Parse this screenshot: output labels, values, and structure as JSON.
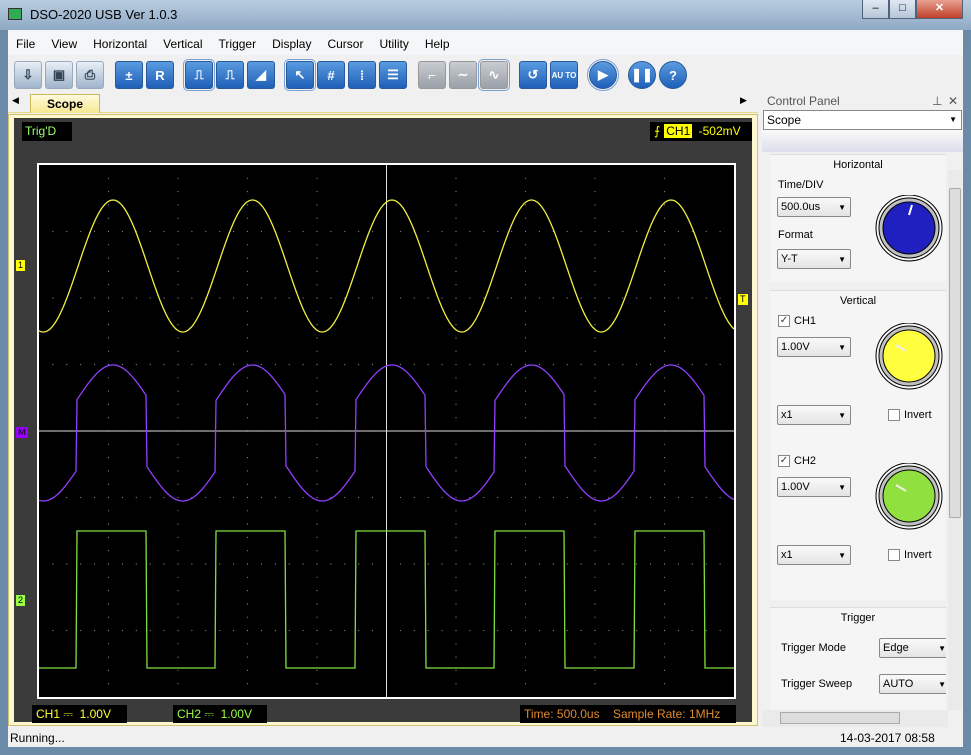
{
  "window": {
    "title": "DSO-2020 USB Ver 1.0.3",
    "minimize": "‒",
    "maximize": "□",
    "close": "✕"
  },
  "menu": [
    "File",
    "View",
    "Horizontal",
    "Vertical",
    "Trigger",
    "Display",
    "Cursor",
    "Utility",
    "Help"
  ],
  "toolbar": [
    {
      "name": "open-icon",
      "glyph": "⇩"
    },
    {
      "name": "save-icon",
      "glyph": "▣"
    },
    {
      "name": "print-icon",
      "glyph": "⎙"
    },
    {
      "name": "math-icon",
      "glyph": "±"
    },
    {
      "name": "reference-icon",
      "glyph": "R"
    },
    {
      "name": "pulse-icon",
      "glyph": "⎍"
    },
    {
      "name": "pulse-dotted-icon",
      "glyph": "⎍"
    },
    {
      "name": "ramp-icon",
      "glyph": "◢"
    },
    {
      "name": "pointer-icon",
      "glyph": "↖"
    },
    {
      "name": "grid-icon",
      "glyph": "#"
    },
    {
      "name": "vertical-cursor-icon",
      "glyph": "⁞"
    },
    {
      "name": "horizontal-cursor-icon",
      "glyph": "☰"
    },
    {
      "name": "step-icon",
      "glyph": "⌐"
    },
    {
      "name": "wave-icon",
      "glyph": "∼"
    },
    {
      "name": "sine-icon",
      "glyph": "∿"
    },
    {
      "name": "reset-icon",
      "glyph": "↺"
    },
    {
      "name": "auto-icon",
      "glyph": "AU TO"
    },
    {
      "name": "run-icon",
      "glyph": "▶"
    },
    {
      "name": "pause-icon",
      "glyph": "❚❚"
    },
    {
      "name": "help-icon",
      "glyph": "?"
    }
  ],
  "tab": {
    "label": "Scope"
  },
  "scope": {
    "trig_status": "Trig'D",
    "trigger_channel": "CH1",
    "trigger_level": "-502mV",
    "markers": {
      "ch1": "1",
      "math": "M",
      "ch2": "2",
      "trigger": "T"
    },
    "ch1_label": "CH1",
    "ch1_coupling": "⎓",
    "ch1_scale": "1.00V",
    "ch2_label": "CH2",
    "ch2_coupling": "⎓",
    "ch2_scale": "1.00V",
    "time": "Time: 500.0us",
    "sample_rate": "Sample Rate: 1MHz",
    "colors": {
      "ch1": "#f0f040",
      "ch2": "#80e040",
      "math": "#9040ff",
      "grid": "#888888"
    }
  },
  "status": {
    "text": "Running...",
    "datetime": "14-03-2017  08:58"
  },
  "panel": {
    "title": "Control Panel",
    "pin": "⊥",
    "close": "✕",
    "view": "Scope",
    "horizontal": {
      "title": "Horizontal",
      "time_div_label": "Time/DIV",
      "time_div": "500.0us",
      "format_label": "Format",
      "format": "Y-T",
      "knob_color": "#2020c0"
    },
    "vertical": {
      "title": "Vertical",
      "ch1": {
        "label": "CH1",
        "checked": true,
        "volts": "1.00V",
        "probe": "x1",
        "invert": "Invert",
        "knob_color": "#ffff40"
      },
      "ch2": {
        "label": "CH2",
        "checked": true,
        "volts": "1.00V",
        "probe": "x1",
        "invert": "Invert",
        "knob_color": "#90e040"
      }
    },
    "trigger": {
      "title": "Trigger",
      "mode_label": "Trigger Mode",
      "mode": "Edge",
      "sweep_label": "Trigger Sweep",
      "sweep": "AUTO"
    }
  }
}
